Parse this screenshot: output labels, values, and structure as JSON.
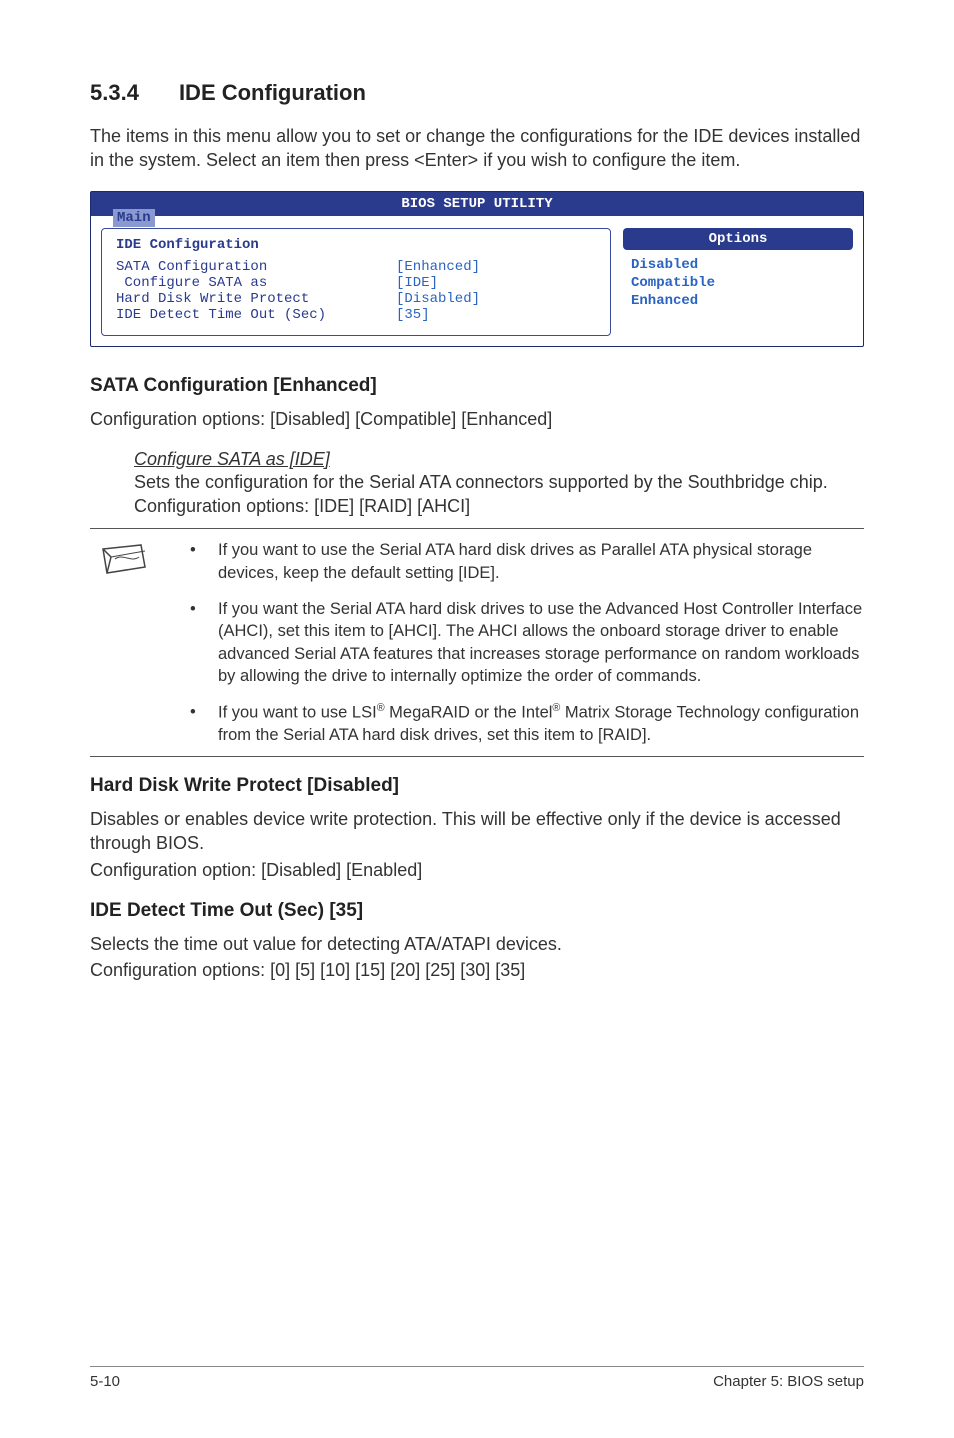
{
  "section": {
    "number": "5.3.4",
    "title": "IDE Configuration",
    "intro": "The items in this menu allow you to set or change the configurations for the IDE devices installed in the system. Select an item then press <Enter> if you wish to configure the item."
  },
  "bios": {
    "utility_title": "BIOS SETUP UTILITY",
    "tab": "Main",
    "heading": "IDE Configuration",
    "rows": [
      {
        "label": "SATA Configuration",
        "value": "[Enhanced]"
      },
      {
        "label": " Configure SATA as",
        "value": "[IDE]"
      },
      {
        "label": "",
        "value": ""
      },
      {
        "label": "Hard Disk Write Protect",
        "value": "[Disabled]"
      },
      {
        "label": "IDE Detect Time Out (Sec)",
        "value": "[35]"
      }
    ],
    "options_header": "Options",
    "options": [
      "Disabled",
      "Compatible",
      "Enhanced"
    ]
  },
  "sata": {
    "heading": "SATA Configuration [Enhanced]",
    "options_line": "Configuration options: [Disabled] [Compatible] [Enhanced]",
    "sub_heading": "Configure SATA as [IDE]",
    "sub_text1": "Sets the configuration for the Serial ATA connectors supported by the Southbridge chip. Configuration options: [IDE] [RAID] [AHCI]"
  },
  "notes": {
    "item1": "If you want to use the Serial ATA hard disk drives as Parallel ATA physical storage devices, keep the default setting [IDE].",
    "item2": "If you want the Serial ATA hard disk drives to use the Advanced Host Controller Interface (AHCI), set this item to [AHCI]. The AHCI allows the onboard storage driver to enable advanced Serial ATA features that increases storage performance on random workloads by allowing the drive to internally optimize the order of commands.",
    "item3_a": "If you want to use LSI",
    "item3_b": " MegaRAID or the Intel",
    "item3_c": " Matrix Storage Technology configuration from the Serial ATA hard disk drives, set this item to [RAID]."
  },
  "hdwp": {
    "heading": "Hard Disk Write Protect [Disabled]",
    "text": "Disables or enables device write protection. This will be effective only if the device is accessed through BIOS.",
    "opts": "Configuration option: [Disabled] [Enabled]"
  },
  "ide_to": {
    "heading": "IDE Detect Time Out (Sec) [35]",
    "text": "Selects the time out value for detecting ATA/ATAPI devices.",
    "opts": "Configuration options: [0] [5] [10] [15] [20] [25] [30] [35]"
  },
  "footer": {
    "left": "5-10",
    "right": "Chapter 5: BIOS setup"
  }
}
